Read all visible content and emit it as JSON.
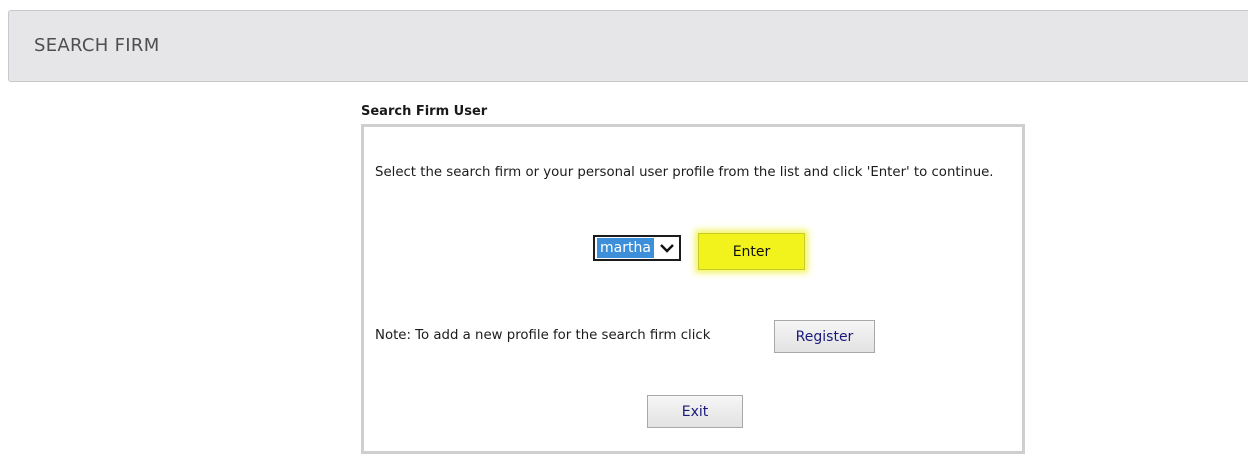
{
  "header": {
    "title": "SEARCH FIRM"
  },
  "section": {
    "label": "Search Firm User"
  },
  "panel": {
    "instructions": "Select the search firm or your personal user profile from the list and click 'Enter' to continue.",
    "profile_select": {
      "selected": "martha",
      "icon": "chevron-down-icon"
    },
    "enter_label": "Enter",
    "note": "Note: To add a new profile for the search firm click",
    "register_label": "Register",
    "exit_label": "Exit"
  },
  "colors": {
    "header_bg": "#e6e6e8",
    "selection": "#3c8fd8",
    "highlight": "#f2f21c",
    "button_text": "#1a1a7a"
  }
}
